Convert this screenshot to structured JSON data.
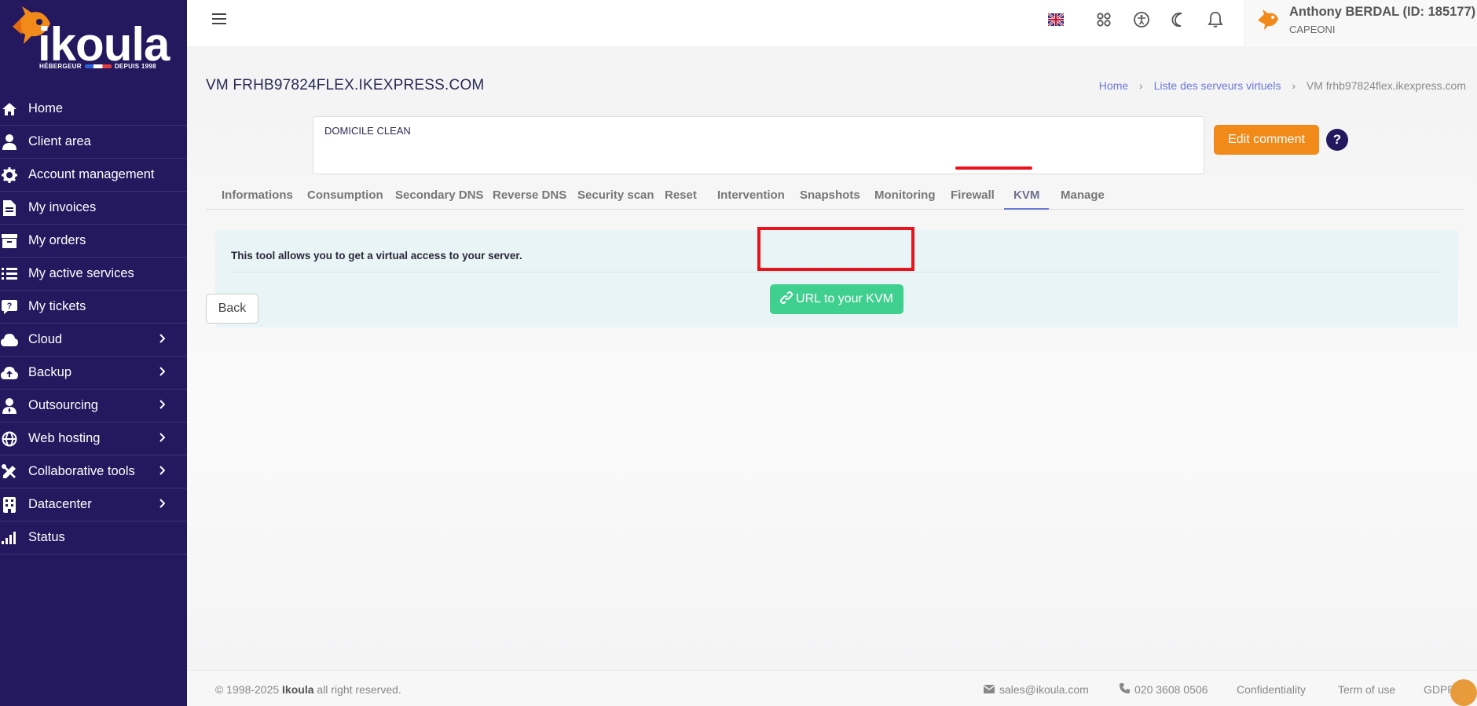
{
  "brand": {
    "name": "ikoula",
    "tagline_left": "HÉBERGEUR",
    "tagline_right": "DEPUIS 1998"
  },
  "sidebar": {
    "items": [
      {
        "label": "Home",
        "icon": "home-icon",
        "has_children": false
      },
      {
        "label": "Client area",
        "icon": "user-icon",
        "has_children": false
      },
      {
        "label": "Account management",
        "icon": "gear-icon",
        "has_children": false
      },
      {
        "label": "My invoices",
        "icon": "file-invoice-icon",
        "has_children": false
      },
      {
        "label": "My orders",
        "icon": "box-icon",
        "has_children": false
      },
      {
        "label": "My active services",
        "icon": "list-icon",
        "has_children": false
      },
      {
        "label": "My tickets",
        "icon": "ticket-question-icon",
        "has_children": false
      },
      {
        "label": "Cloud",
        "icon": "cloud-icon",
        "has_children": true
      },
      {
        "label": "Backup",
        "icon": "cloud-upload-icon",
        "has_children": true
      },
      {
        "label": "Outsourcing",
        "icon": "user-tie-icon",
        "has_children": true
      },
      {
        "label": "Web hosting",
        "icon": "globe-icon",
        "has_children": true
      },
      {
        "label": "Collaborative tools",
        "icon": "tools-icon",
        "has_children": true
      },
      {
        "label": "Datacenter",
        "icon": "building-icon",
        "has_children": true
      },
      {
        "label": "Status",
        "icon": "signal-icon",
        "has_children": false
      }
    ]
  },
  "topbar": {
    "user_name": "Anthony BERDAL (ID: 185177)",
    "company": "CAPEONI"
  },
  "page": {
    "title": "VM FRHB97824FLEX.IKEXPRESS.COM",
    "breadcrumb": [
      "Home",
      "Liste des serveurs virtuels",
      "VM frhb97824flex.ikexpress.com"
    ],
    "comment": "DOMICILE CLEAN",
    "edit_comment_label": "Edit comment",
    "help_label": "?",
    "tabs": [
      {
        "label": "Informations",
        "active": false
      },
      {
        "label": "Consumption",
        "active": false
      },
      {
        "label": "Secondary DNS",
        "active": false
      },
      {
        "label": "Reverse DNS",
        "active": false
      },
      {
        "label": "Security scan",
        "active": false
      },
      {
        "label": "Reset",
        "active": false
      },
      {
        "label": "Intervention",
        "active": false
      },
      {
        "label": "Snapshots",
        "active": false
      },
      {
        "label": "Monitoring",
        "active": false
      },
      {
        "label": "Firewall",
        "active": false
      },
      {
        "label": "KVM",
        "active": true
      },
      {
        "label": "Manage",
        "active": false
      }
    ],
    "kvm_description": "This tool allows you to get a virtual access to your server.",
    "kvm_button_label": "URL to your KVM",
    "back_label": "Back"
  },
  "footer": {
    "copyright_prefix": "© 1998-2025",
    "copyright_brand": "Ikoula",
    "copyright_suffix": "all right reserved.",
    "email": "sales@ikoula.com",
    "phone": "020 3608 0506",
    "confidentiality": "Confidentiality",
    "terms": "Term of use",
    "gdpr": "GDPR"
  },
  "colors": {
    "sidebar_bg": "#24185e",
    "accent_orange": "#f28a1a",
    "kvm_green": "#3fcf8e",
    "highlight_red": "#e8141c",
    "link_blue": "#6b78d6"
  }
}
